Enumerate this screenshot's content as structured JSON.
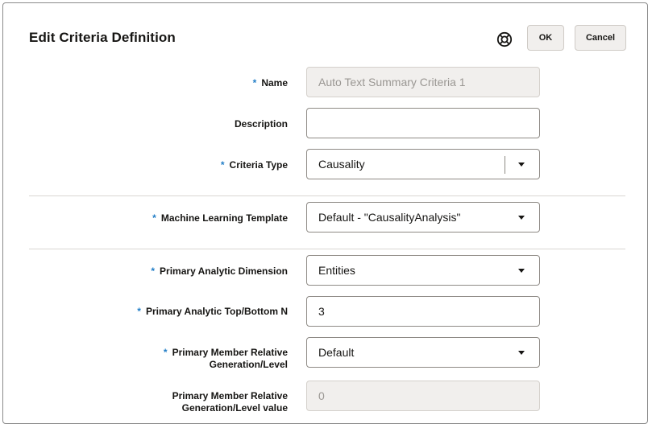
{
  "dialog": {
    "title": "Edit Criteria Definition",
    "ok_label": "OK",
    "cancel_label": "Cancel"
  },
  "fields": {
    "name": {
      "label": "Name",
      "required": "*",
      "value": "Auto Text Summary Criteria 1"
    },
    "description": {
      "label": "Description",
      "value": ""
    },
    "criteria_type": {
      "label": "Criteria Type",
      "required": "*",
      "value": "Causality"
    },
    "ml_template": {
      "label": "Machine Learning Template",
      "required": "*",
      "value": "Default - \"CausalityAnalysis\""
    },
    "primary_dimension": {
      "label": "Primary Analytic Dimension",
      "required": "*",
      "value": "Entities"
    },
    "top_bottom_n": {
      "label": "Primary Analytic Top/Bottom N",
      "required": "*",
      "value": "3"
    },
    "relative_generation": {
      "label_line1": "Primary Member Relative",
      "label_line2": "Generation/Level",
      "required": "*",
      "value": "Default"
    },
    "relative_generation_value": {
      "label_line1": "Primary Member Relative",
      "label_line2": "Generation/Level value",
      "value": "0"
    }
  },
  "icons": {
    "help": "lifebuoy-help-icon",
    "dropdown": "chevron-down-icon"
  },
  "colors": {
    "required_marker": "#227ec7",
    "button_bg": "#f1efed",
    "disabled_bg": "#f1efed"
  }
}
